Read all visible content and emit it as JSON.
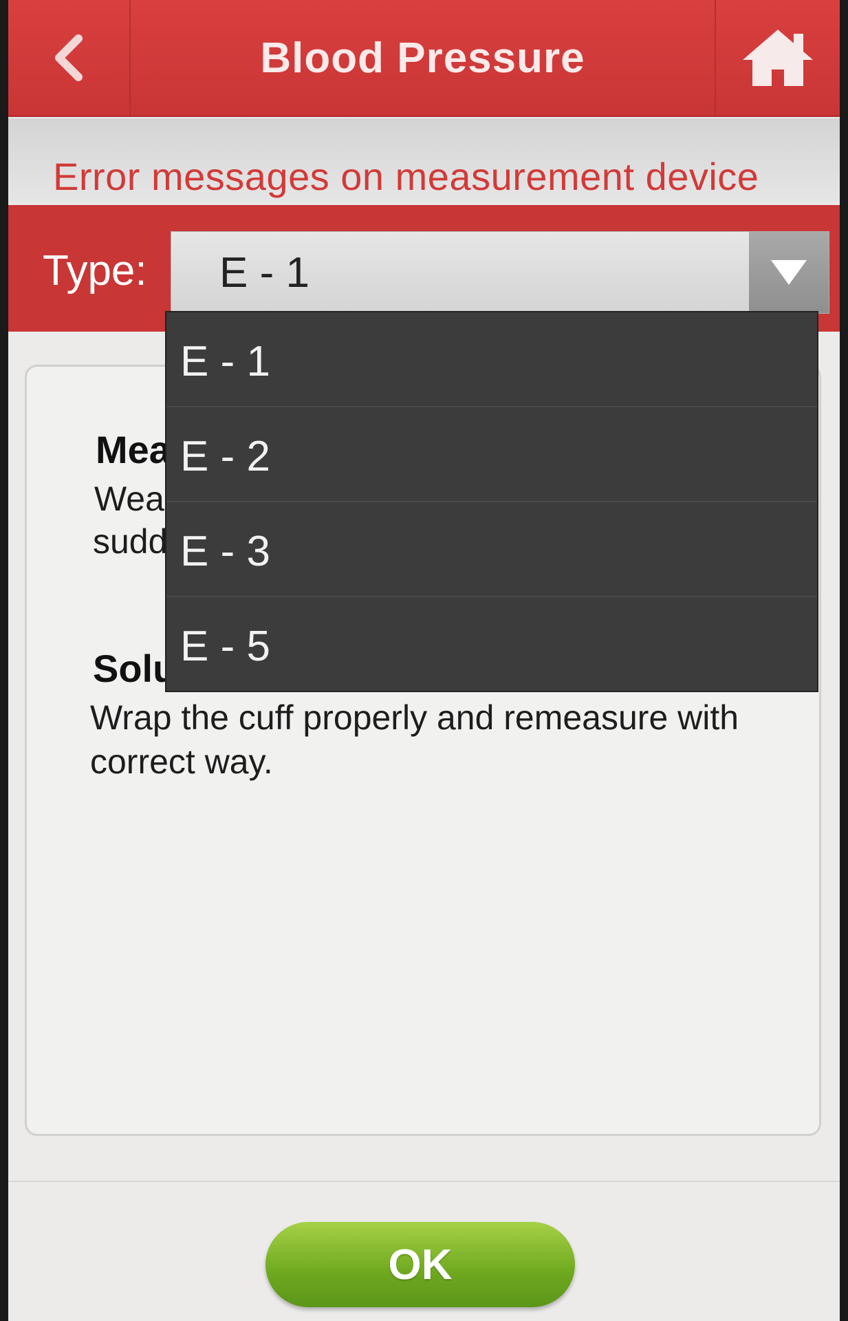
{
  "header": {
    "title": "Blood Pressure",
    "back_icon": "chevron-left-icon",
    "home_icon": "home-icon"
  },
  "subtitle": "Error messages on measurement device",
  "type_selector": {
    "label": "Type:",
    "selected": "E - 1",
    "arrow_icon": "triangle-down-icon",
    "options": [
      "E - 1",
      "E - 2",
      "E - 3",
      "E - 5"
    ]
  },
  "card": {
    "heading_1": "Mea",
    "text_1_line_1": "Weal",
    "text_1_line_2": "sudd",
    "heading_2": "Solu",
    "text_2": "Wrap the cuff properly and remeasure with correct way."
  },
  "footer": {
    "ok_label": "OK"
  },
  "colors": {
    "header_red": "#d9403f",
    "subtitle_red": "#d23a38",
    "ok_green": "#7bb526",
    "dropdown_bg": "#3c3c3c"
  }
}
